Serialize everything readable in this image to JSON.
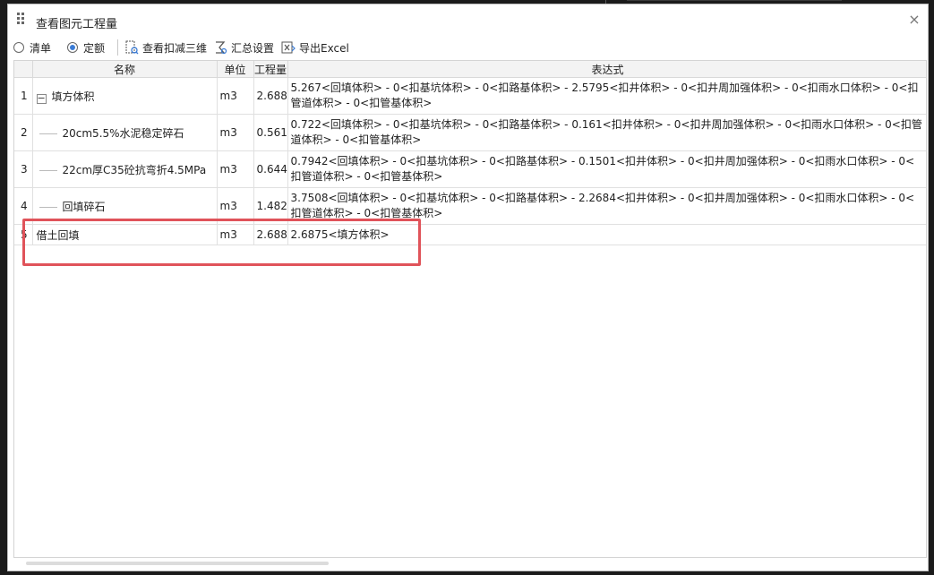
{
  "window": {
    "title": "查看图元工程量"
  },
  "toolbar": {
    "radio_list": "清单",
    "radio_quota": "定额",
    "radio_quota_checked": true,
    "view_deduct_3d": "查看扣减三维",
    "summary_settings": "汇总设置",
    "export_excel": "导出Excel"
  },
  "table": {
    "headers": {
      "index": "",
      "name": "名称",
      "unit": "单位",
      "quantity": "工程量",
      "expression": "表达式"
    },
    "rows": [
      {
        "index": "1",
        "name": "填方体积",
        "unit": "m3",
        "quantity": "2.688",
        "expression": "5.267<回填体积> - 0<扣基坑体积> - 0<扣路基体积> - 2.5795<扣井体积> - 0<扣井周加强体积> - 0<扣雨水口体积> - 0<扣管道体积> - 0<扣管基体积>"
      },
      {
        "index": "2",
        "name": "20cm5.5%水泥稳定碎石",
        "unit": "m3",
        "quantity": "0.561",
        "expression": "0.722<回填体积> - 0<扣基坑体积> - 0<扣路基体积> - 0.161<扣井体积> - 0<扣井周加强体积> - 0<扣雨水口体积> - 0<扣管道体积> - 0<扣管基体积>"
      },
      {
        "index": "3",
        "name": "22cm厚C35砼抗弯折4.5MPa",
        "unit": "m3",
        "quantity": "0.644",
        "expression": "0.7942<回填体积> - 0<扣基坑体积> - 0<扣路基体积> - 0.1501<扣井体积> - 0<扣井周加强体积> - 0<扣雨水口体积> - 0<扣管道体积> - 0<扣管基体积>"
      },
      {
        "index": "4",
        "name": "回填碎石",
        "unit": "m3",
        "quantity": "1.482",
        "expression": "3.7508<回填体积> - 0<扣基坑体积> - 0<扣路基体积> - 2.2684<扣井体积> - 0<扣井周加强体积> - 0<扣雨水口体积> - 0<扣管道体积> - 0<扣管基体积>"
      },
      {
        "index": "5",
        "name": "借土回填",
        "unit": "m3",
        "quantity": "2.688",
        "expression": "2.6875<填方体积>"
      }
    ]
  },
  "colors": {
    "highlight": "#e0535a",
    "radio_accent": "#3a7bd5"
  }
}
